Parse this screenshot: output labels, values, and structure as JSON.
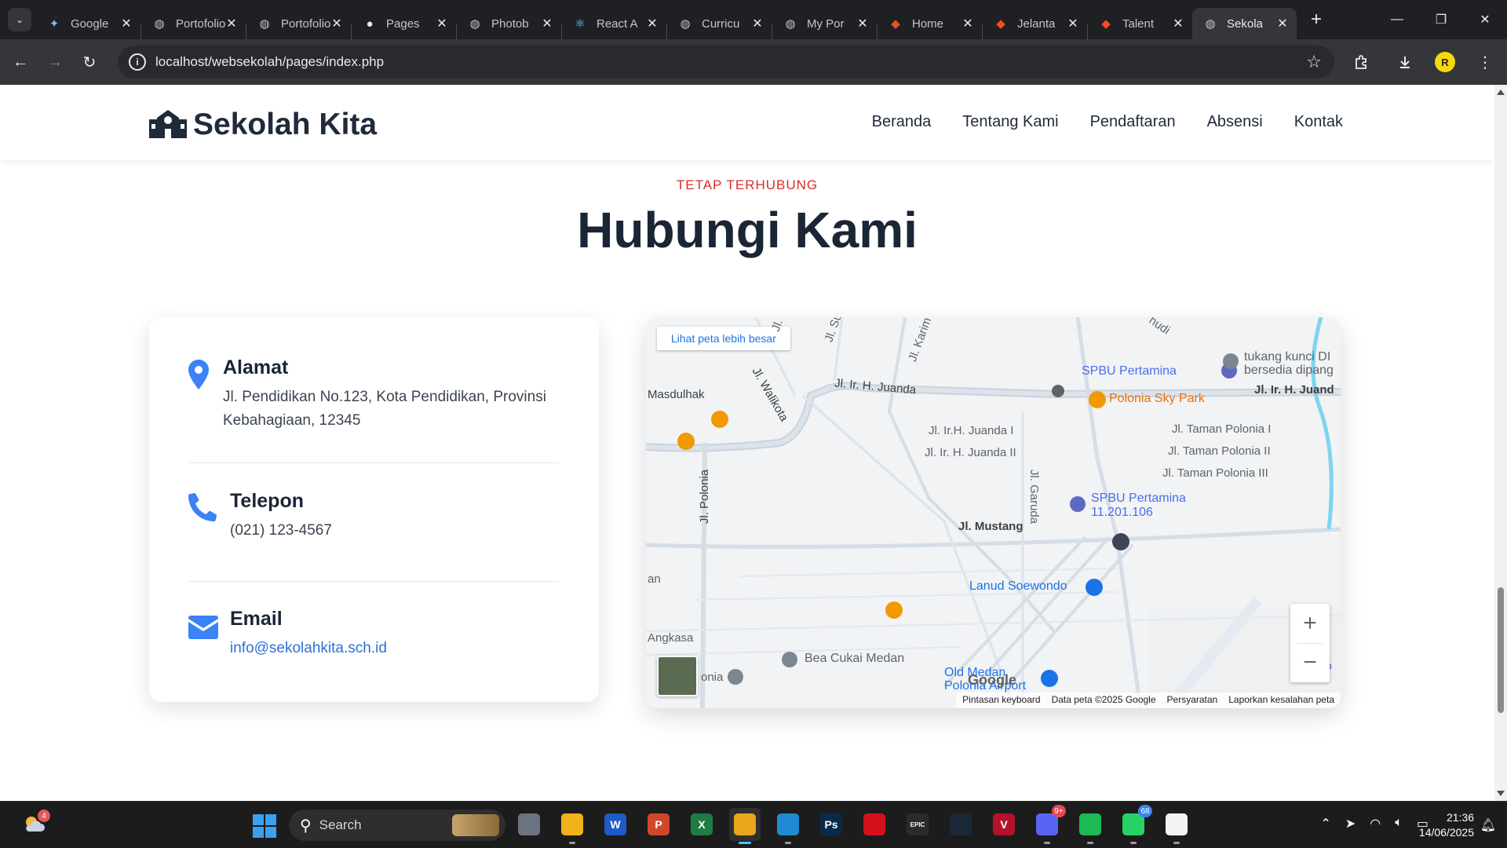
{
  "browser": {
    "tabs": [
      {
        "title": "Google",
        "icon": "gemini-icon"
      },
      {
        "title": "Portofolio",
        "icon": "globe-icon"
      },
      {
        "title": "Portofolio",
        "icon": "globe-icon"
      },
      {
        "title": "Pages",
        "icon": "github-icon"
      },
      {
        "title": "Photob",
        "icon": "globe-icon"
      },
      {
        "title": "React A",
        "icon": "react-icon"
      },
      {
        "title": "Curricu",
        "icon": "globe-icon"
      },
      {
        "title": "My Por",
        "icon": "globe-icon"
      },
      {
        "title": "Home",
        "icon": "figma-icon"
      },
      {
        "title": "Jelanta",
        "icon": "figma-icon"
      },
      {
        "title": "Talent",
        "icon": "figma-icon"
      },
      {
        "title": "Sekola",
        "icon": "globe-icon",
        "active": true
      }
    ],
    "url": "localhost/websekolah/pages/index.php",
    "profile_initial": "R"
  },
  "site": {
    "brand": "Sekolah Kita",
    "nav": [
      "Beranda",
      "Tentang Kami",
      "Pendaftaran",
      "Absensi",
      "Kontak"
    ]
  },
  "contact_section": {
    "eyebrow": "TETAP TERHUBUNG",
    "title": "Hubungi Kami",
    "items": [
      {
        "label": "Alamat",
        "value": "Jl. Pendidikan No.123, Kota Pendidikan, Provinsi Kebahagiaan, 12345",
        "icon": "map-pin-icon"
      },
      {
        "label": "Telepon",
        "value": "(021) 123-4567",
        "icon": "phone-icon"
      },
      {
        "label": "Email",
        "value": "info@sekolahkita.sch.id",
        "icon": "envelope-icon"
      }
    ],
    "accent_color": "#3b82f6"
  },
  "map": {
    "larger_map_link": "Lihat peta lebih besar",
    "street_labels": [
      "Jl. Ir. H. Juanda",
      "Jl. Ir. H. Juand",
      "Jl. Ir.H. Juanda I",
      "Jl. Ir. H. Juanda II",
      "Jl. Taman Polonia I",
      "Jl. Taman Polonia II",
      "Jl. Taman Polonia III",
      "Jl. Mustang",
      "Jl. Polonia",
      "Jl. Garuda",
      "Jl. Walikota",
      "Jl. Karim",
      "Masdulhak",
      "Angkasa",
      "an",
      "onia",
      "Jl. Su",
      "Jl.",
      "hudi"
    ],
    "places": [
      {
        "name": "SPBU Pertamina",
        "color": "#4b6cf0"
      },
      {
        "name": "Polonia Sky Park",
        "color": "#e8710a"
      },
      {
        "name": "tukang kunci DI bersedia dipang",
        "color": "#5f6368"
      },
      {
        "name": "SPBU Pertamina 11.201.106",
        "color": "#4b6cf0"
      },
      {
        "name": "Lanud Soewondo",
        "color": "#1a73e8"
      },
      {
        "name": "Bea Cukai Medan",
        "color": "#5f6368"
      },
      {
        "name": "Old Medan Polonia Airport",
        "color": "#1a73e8"
      }
    ],
    "attribution": [
      "Pintasan keyboard",
      "Data peta ©2025 Google",
      "Persyaratan",
      "Laporkan kesalahan peta"
    ],
    "google_logo": "Google",
    "zoom_in": "+",
    "zoom_out": "−",
    "edge_text": "ko"
  },
  "taskbar": {
    "search_placeholder": "Search",
    "weather_badge": "4",
    "apps": [
      {
        "name": "task-view",
        "color": "#6b7280",
        "label": ""
      },
      {
        "name": "file-explorer",
        "color": "#f2b21b",
        "label": ""
      },
      {
        "name": "word",
        "color": "#1e5bc6",
        "label": "W"
      },
      {
        "name": "powerpoint",
        "color": "#d2472a",
        "label": "P"
      },
      {
        "name": "excel",
        "color": "#1e7c45",
        "label": "X"
      },
      {
        "name": "chrome",
        "color": "#e8a71c",
        "label": "",
        "active": true
      },
      {
        "name": "vscode",
        "color": "#1f8ad2",
        "label": ""
      },
      {
        "name": "photoshop",
        "color": "#0a2a4a",
        "label": "Ps"
      },
      {
        "name": "app-red",
        "color": "#d4111a",
        "label": ""
      },
      {
        "name": "epic-games",
        "color": "#2b2b2b",
        "label": "EPIC"
      },
      {
        "name": "steam",
        "color": "#1b2838",
        "label": ""
      },
      {
        "name": "valorant",
        "color": "#b3122b",
        "label": "V"
      },
      {
        "name": "discord",
        "color": "#5865f2",
        "label": "",
        "badge": "9+"
      },
      {
        "name": "spotify",
        "color": "#1db954",
        "label": ""
      },
      {
        "name": "whatsapp",
        "color": "#25d366",
        "label": "",
        "badge": "68"
      },
      {
        "name": "notepad",
        "color": "#f3f3f3",
        "label": ""
      }
    ],
    "time": "21:36",
    "date": "14/06/2025"
  }
}
